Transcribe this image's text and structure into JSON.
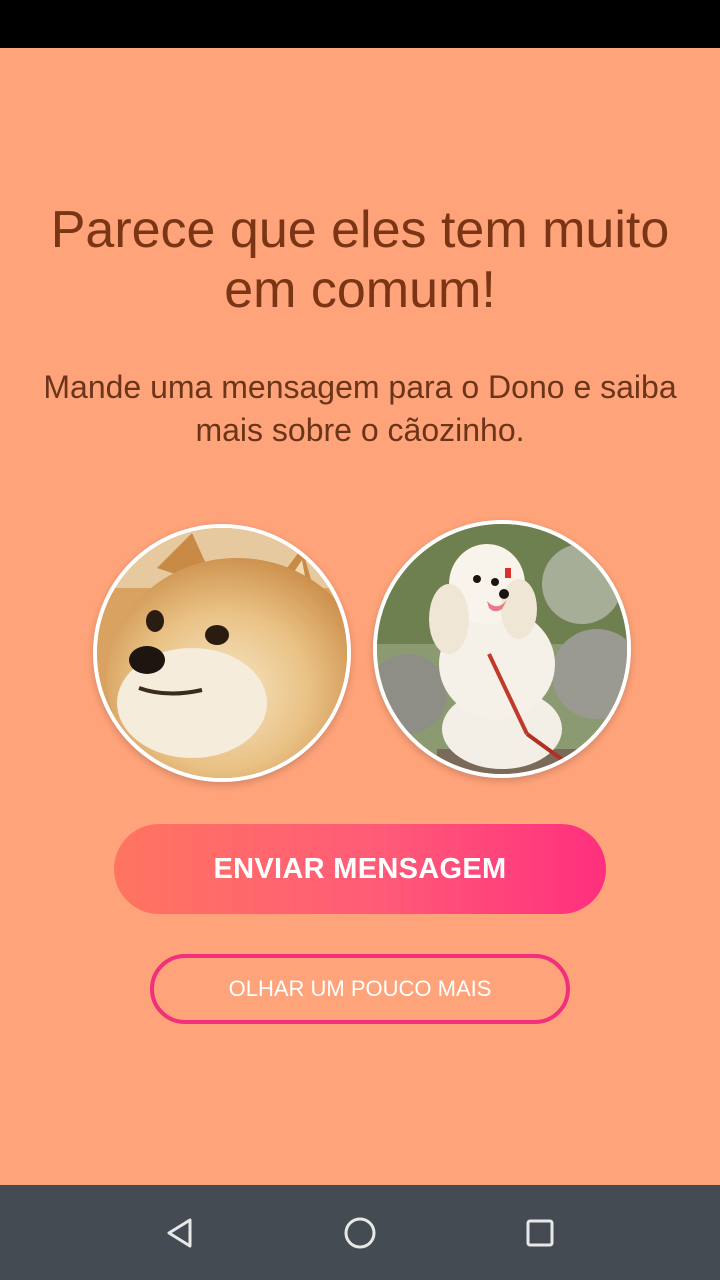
{
  "match": {
    "title": "Parece que eles tem muito em comum!",
    "subtitle": "Mande uma mensagem para o Dono e saiba mais sobre o cãozinho."
  },
  "avatars": {
    "left": "shiba-inu-dog-photo",
    "right": "white-poodle-dog-photo"
  },
  "actions": {
    "send_message_label": "ENVIAR MENSAGEM",
    "keep_browsing_label": "OLHAR UM POUCO MAIS"
  },
  "navigation": {
    "back_icon": "back-triangle-icon",
    "home_icon": "home-circle-icon",
    "recents_icon": "recents-square-icon"
  },
  "colors": {
    "background": "#ffa37a",
    "title_text": "#7a3515",
    "gradient_start": "#ff7560",
    "gradient_end": "#ff2f7e",
    "outline_button": "#f22f7b",
    "nav_bar": "#454b52"
  }
}
